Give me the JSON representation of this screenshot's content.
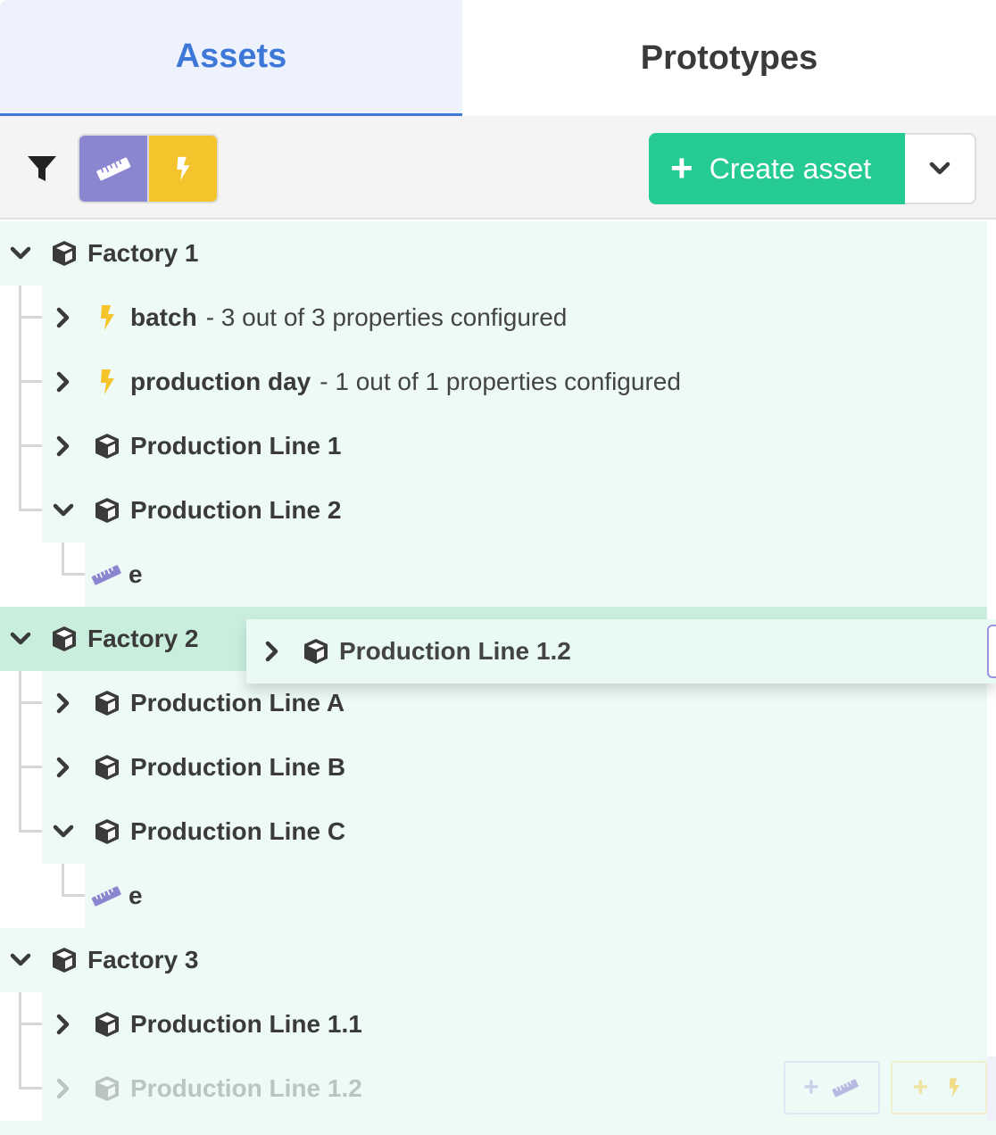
{
  "tabs": [
    {
      "label": "Assets",
      "active": true
    },
    {
      "label": "Prototypes",
      "active": false
    }
  ],
  "toolbar": {
    "filter_icon": "filter-icon",
    "type_filters": [
      {
        "type": "measurement",
        "icon": "ruler-icon",
        "color": "#8b86d0",
        "active": true
      },
      {
        "type": "event",
        "icon": "lightning-icon",
        "color": "#f5c32c",
        "active": true
      }
    ],
    "create_label": "Create asset",
    "create_color": "#26cb91"
  },
  "tree": [
    {
      "label": "Factory 1",
      "type": "asset",
      "expanded": true,
      "children": [
        {
          "label": "batch",
          "type": "event",
          "description": "- 3 out of 3 properties configured"
        },
        {
          "label": "production day",
          "type": "event",
          "description": "- 1 out of 1 properties configured"
        },
        {
          "label": "Production Line 1",
          "type": "asset",
          "expanded": false
        },
        {
          "label": "Production Line 2",
          "type": "asset",
          "expanded": true,
          "children": [
            {
              "label": "e",
              "type": "measurement"
            }
          ]
        }
      ]
    },
    {
      "label": "Factory 2",
      "type": "asset",
      "expanded": true,
      "highlighted": true,
      "children": [
        {
          "label": "Production Line A",
          "type": "asset",
          "expanded": false
        },
        {
          "label": "Production Line B",
          "type": "asset",
          "expanded": false
        },
        {
          "label": "Production Line C",
          "type": "asset",
          "expanded": true,
          "children": [
            {
              "label": "e",
              "type": "measurement"
            }
          ]
        }
      ]
    },
    {
      "label": "Factory 3",
      "type": "asset",
      "expanded": true,
      "children": [
        {
          "label": "Production Line 1.1",
          "type": "asset",
          "expanded": false
        },
        {
          "label": "Production Line 1.2",
          "type": "asset",
          "expanded": false,
          "dragging": true
        }
      ]
    }
  ],
  "drag_ghost": {
    "label": "Production Line 1.2"
  },
  "row_actions": [
    {
      "name": "add-measurement",
      "icons": [
        "plus-icon",
        "ruler-icon"
      ]
    },
    {
      "name": "add-event",
      "icons": [
        "plus-icon",
        "lightning-icon"
      ]
    }
  ]
}
